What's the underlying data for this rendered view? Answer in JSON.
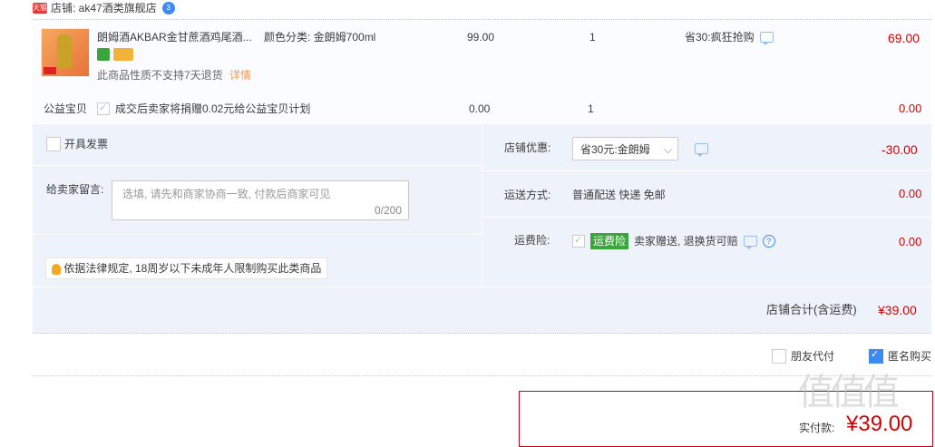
{
  "shop": {
    "badge": "天猫",
    "label": "店铺: ak47酒类旗舰店",
    "dot": "3"
  },
  "product": {
    "title": "朗姆酒AKBAR金甘蔗酒鸡尾酒...",
    "sku": "颜色分类: 金朗姆700ml",
    "price": "99.00",
    "qty": "1",
    "promo": "省30:疯狂抢购",
    "subtotal": "69.00",
    "no_return": "此商品性质不支持7天退货",
    "detail_link": "详情"
  },
  "welfare": {
    "label": "公益宝贝",
    "text": "成交后卖家将捐赠0.02元给公益宝贝计划",
    "price": "0.00",
    "qty": "1",
    "subtotal": "0.00"
  },
  "invoice": {
    "label": "开具发票"
  },
  "message": {
    "label": "给卖家留言:",
    "placeholder": "选填, 请先和商家协商一致, 付款后商家可见",
    "counter": "0/200"
  },
  "shop_discount": {
    "label": "店铺优惠:",
    "selected": "省30元:金朗姆",
    "amount": "-30.00"
  },
  "shipping": {
    "label": "运送方式:",
    "value": "普通配送 快递 免邮",
    "amount": "0.00"
  },
  "insurance": {
    "label": "运费险:",
    "tag": "运费险",
    "text": "卖家赠送, 退换货可赔",
    "amount": "0.00"
  },
  "legal_notice": "依据法律规定, 18周岁以下未成年人限制购买此类商品",
  "total": {
    "label": "店铺合计(含运费)",
    "amount": "¥39.00"
  },
  "options": {
    "friend_pay": "朋友代付",
    "anonymous": "匿名购买"
  },
  "pay": {
    "label": "实付款:",
    "amount": "¥39.00"
  },
  "watermark": "值值值"
}
